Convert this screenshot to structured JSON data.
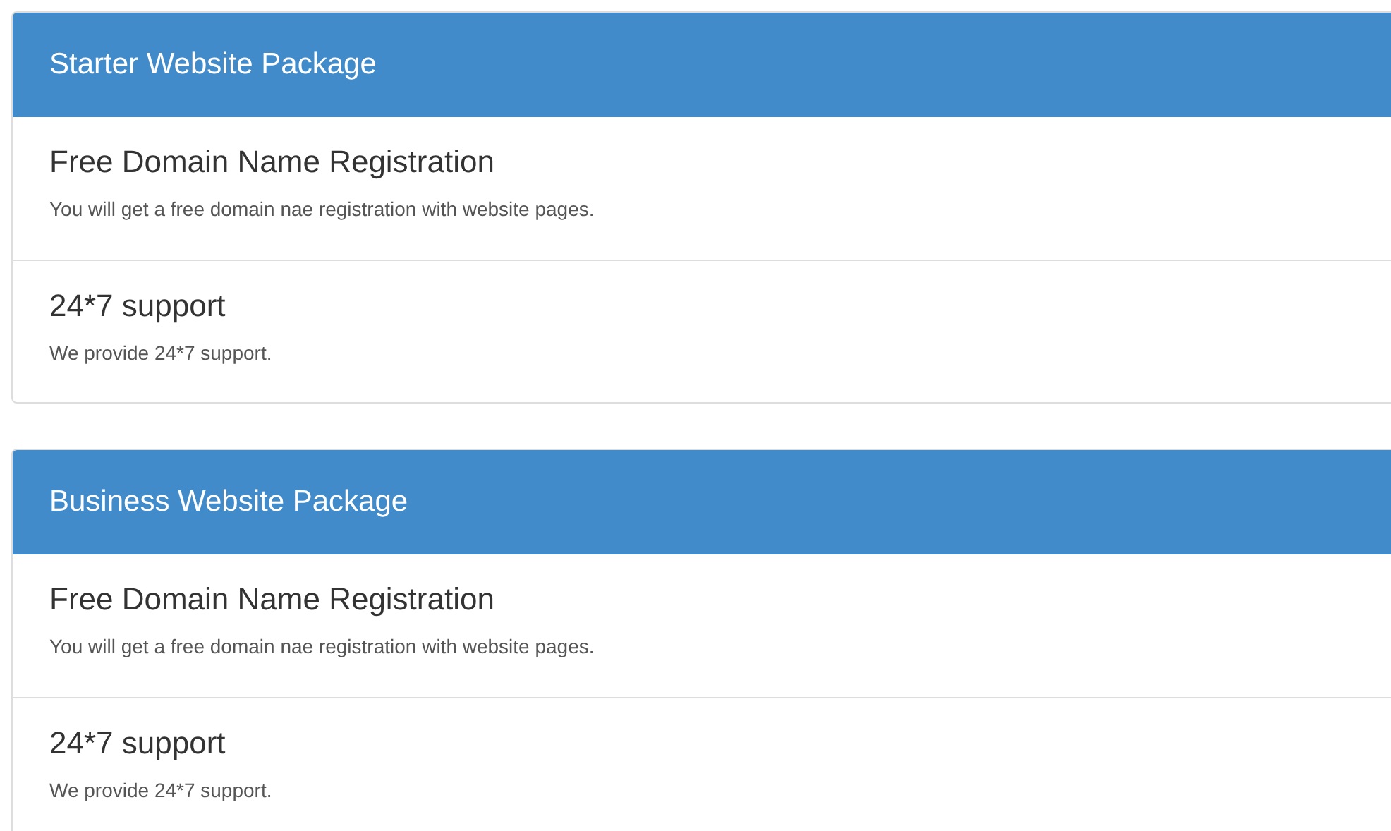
{
  "packages": [
    {
      "title": "Starter Website Package",
      "features": [
        {
          "name": "Free Domain Name Registration",
          "description": "You will get a free domain nae registration with website pages."
        },
        {
          "name": "24*7 support",
          "description": "We provide 24*7 support."
        }
      ]
    },
    {
      "title": "Business Website Package",
      "features": [
        {
          "name": "Free Domain Name Registration",
          "description": "You will get a free domain nae registration with website pages."
        },
        {
          "name": "24*7 support",
          "description": "We provide 24*7 support."
        }
      ]
    }
  ]
}
